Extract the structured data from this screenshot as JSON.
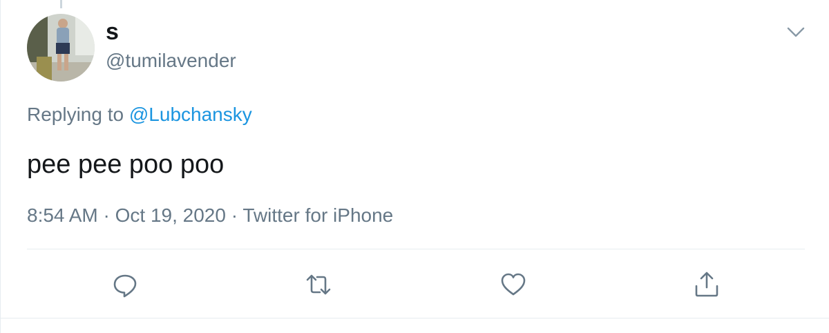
{
  "user": {
    "display_name": "s",
    "handle": "@tumilavender"
  },
  "reply": {
    "prefix": "Replying to",
    "mention": "@Lubchansky"
  },
  "tweet": {
    "text": "pee pee poo poo"
  },
  "meta": {
    "time": "8:54 AM",
    "separator1": "·",
    "date": "Oct 19, 2020",
    "separator2": "·",
    "source": "Twitter for iPhone"
  },
  "actions": [
    {
      "icon": "reply-icon"
    },
    {
      "icon": "retweet-icon"
    },
    {
      "icon": "like-icon"
    },
    {
      "icon": "share-icon"
    }
  ],
  "colors": {
    "text_primary": "#14171a",
    "text_secondary": "#657786",
    "link": "#1b95e0",
    "divider": "#e6ecf0"
  }
}
